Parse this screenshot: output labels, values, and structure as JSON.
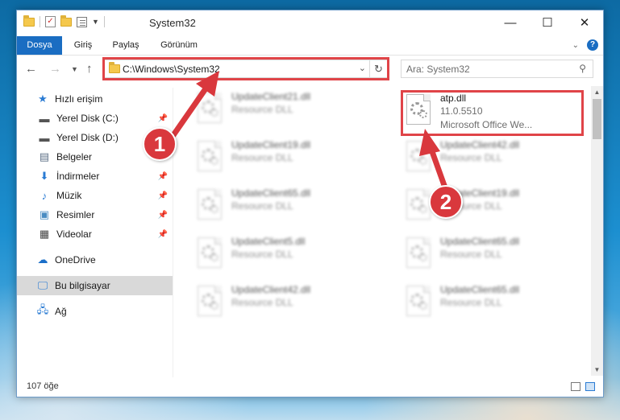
{
  "window": {
    "title": "System32",
    "controls": {
      "minimize": "—",
      "maximize": "☐",
      "close": "✕"
    }
  },
  "ribbon": {
    "tabs": [
      "Dosya",
      "Giriş",
      "Paylaş",
      "Görünüm"
    ]
  },
  "address": {
    "path": "C:\\Windows\\System32",
    "search_placeholder": "Ara: System32"
  },
  "sidebar": {
    "items": [
      {
        "label": "Hızlı erişim",
        "icon": "star-icon",
        "pinned": false
      },
      {
        "label": "Yerel Disk (C:)",
        "icon": "drive-icon",
        "pinned": true
      },
      {
        "label": "Yerel Disk (D:)",
        "icon": "drive-icon",
        "pinned": true
      },
      {
        "label": "Belgeler",
        "icon": "documents-icon",
        "pinned": true
      },
      {
        "label": "İndirmeler",
        "icon": "downloads-icon",
        "pinned": true
      },
      {
        "label": "Müzik",
        "icon": "music-icon",
        "pinned": true
      },
      {
        "label": "Resimler",
        "icon": "pictures-icon",
        "pinned": true
      },
      {
        "label": "Videolar",
        "icon": "videos-icon",
        "pinned": true
      },
      {
        "label": "OneDrive",
        "icon": "cloud-icon",
        "pinned": false
      },
      {
        "label": "Bu bilgisayar",
        "icon": "computer-icon",
        "pinned": false,
        "selected": true
      },
      {
        "label": "Ağ",
        "icon": "network-icon",
        "pinned": false
      }
    ]
  },
  "files": [
    {
      "name": "UpdateClient21.dll",
      "meta": "Resource DLL",
      "blurred": true
    },
    {
      "name": "atp.dll",
      "meta": "11.0.5510",
      "meta2": "Microsoft Office We...",
      "blurred": false,
      "highlighted": true
    },
    {
      "name": "UpdateClient19.dll",
      "meta": "Resource DLL",
      "blurred": true
    },
    {
      "name": "UpdateClient42.dll",
      "meta": "Resource DLL",
      "blurred": true
    },
    {
      "name": "UpdateClient65.dll",
      "meta": "Resource DLL",
      "blurred": true
    },
    {
      "name": "UpdateClient19.dll",
      "meta": "Resource DLL",
      "blurred": true
    },
    {
      "name": "UpdateClient5.dll",
      "meta": "Resource DLL",
      "blurred": true
    },
    {
      "name": "UpdateClient65.dll",
      "meta": "Resource DLL",
      "blurred": true
    },
    {
      "name": "UpdateClient42.dll",
      "meta": "Resource DLL",
      "blurred": true
    },
    {
      "name": "UpdateClient65.dll",
      "meta": "Resource DLL",
      "blurred": true
    }
  ],
  "status": {
    "count": "107 öğe"
  },
  "callouts": {
    "one": "1",
    "two": "2"
  },
  "colors": {
    "accent": "#1a6dc2",
    "highlight": "#e04448",
    "callout": "#d9383d"
  }
}
